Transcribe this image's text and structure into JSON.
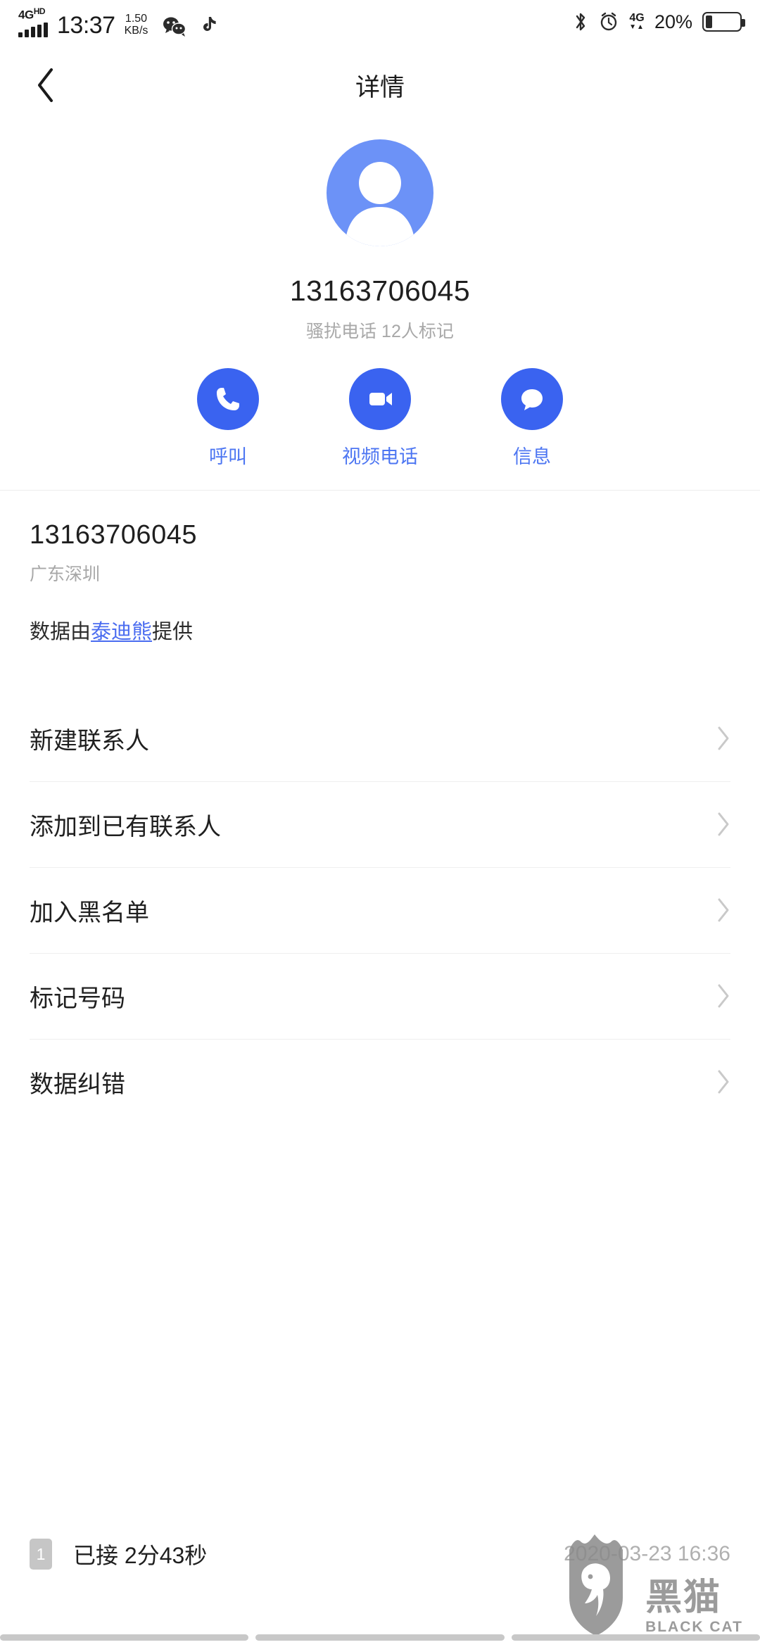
{
  "statusbar": {
    "network_type": "4G",
    "network_suffix": "HD",
    "time": "13:37",
    "speed_value": "1.50",
    "speed_unit": "KB/s",
    "icons": [
      "wechat-icon",
      "tiktok-icon",
      "bluetooth-icon",
      "alarm-icon"
    ],
    "data_label": "4G",
    "battery_percent": "20%"
  },
  "appbar": {
    "back_icon": "chevron-left-icon",
    "title": "详情"
  },
  "profile": {
    "avatar_icon": "person-avatar-icon",
    "phone_number": "13163706045",
    "tag": "骚扰电话  12人标记"
  },
  "actions": [
    {
      "icon": "phone-icon",
      "label": "呼叫"
    },
    {
      "icon": "video-camera-icon",
      "label": "视频电话"
    },
    {
      "icon": "message-bubble-icon",
      "label": "信息"
    }
  ],
  "number_info": {
    "number": "13163706045",
    "location": "广东深圳",
    "source_prefix": "数据由",
    "source_link": "泰迪熊",
    "source_suffix": "提供"
  },
  "menu": [
    {
      "label": "新建联系人",
      "chevron": "chevron-right-icon"
    },
    {
      "label": "添加到已有联系人",
      "chevron": "chevron-right-icon"
    },
    {
      "label": "加入黑名单",
      "chevron": "chevron-right-icon"
    },
    {
      "label": "标记号码",
      "chevron": "chevron-right-icon"
    },
    {
      "label": "数据纠错",
      "chevron": "chevron-right-icon"
    }
  ],
  "call_log": {
    "count_badge": "1",
    "status": "已接  2分43秒",
    "datetime": "2020-03-23 16:36"
  },
  "watermark": {
    "cn": "黑猫",
    "en": "BLACK CAT",
    "icon": "cat-silhouette-icon"
  },
  "colors": {
    "accent_blue": "#3a63f0",
    "label_blue": "#4d76f2",
    "avatar_blue": "#6c92f7",
    "muted": "#a8a8a8"
  }
}
